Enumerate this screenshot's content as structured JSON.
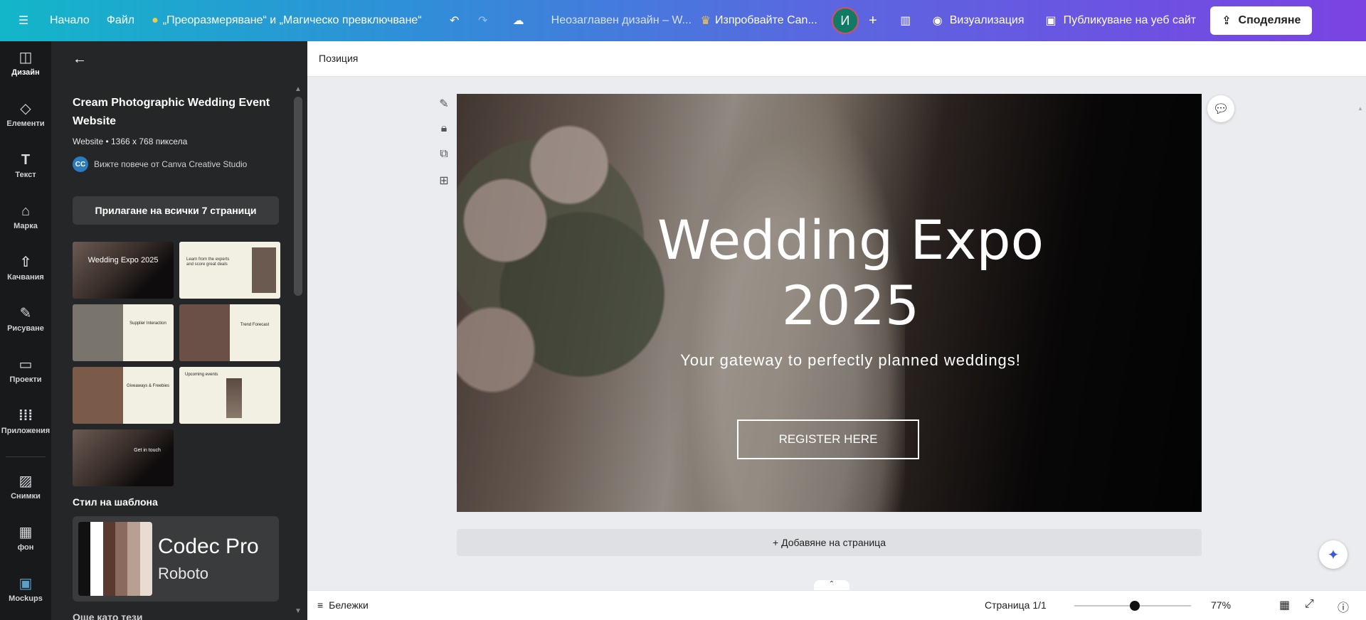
{
  "topbar": {
    "menu_icon": "hamburger-icon",
    "home": "Начало",
    "file": "Файл",
    "promo": "„Преоразмеряване“ и „Магическо превключване“",
    "design_title": "Неозаглавен дизайн – W...",
    "try_canva": "Изпробвайте Can...",
    "avatar_initial": "И",
    "visualize": "Визуализация",
    "publish": "Публикуване на уеб сайт",
    "share": "Споделяне"
  },
  "rail": {
    "items": [
      {
        "label": "Дизайн",
        "icon": "layout-icon"
      },
      {
        "label": "Елементи",
        "icon": "shapes-icon"
      },
      {
        "label": "Текст",
        "icon": "text-icon"
      },
      {
        "label": "Марка",
        "icon": "brand-icon"
      },
      {
        "label": "Качвания",
        "icon": "upload-icon"
      },
      {
        "label": "Рисуване",
        "icon": "draw-icon"
      },
      {
        "label": "Проекти",
        "icon": "folder-icon"
      },
      {
        "label": "Приложения",
        "icon": "apps-icon"
      },
      {
        "label": "Снимки",
        "icon": "photo-icon"
      },
      {
        "label": "фон",
        "icon": "background-icon"
      },
      {
        "label": "Mockups",
        "icon": "mockups-icon"
      }
    ]
  },
  "panel": {
    "template_title": "Cream Photographic Wedding Event Website",
    "template_meta": "Website • 1366 x 768 пиксела",
    "author_badge": "CC",
    "author_text": "Вижте повече от Canva Creative Studio",
    "apply_button": "Прилагане на всички 7 страници",
    "thumbs": [
      {
        "text": "Wedding Expo 2025"
      },
      {
        "text": "Learn from the experts and score great deals"
      },
      {
        "text": "Supplier Interaction"
      },
      {
        "text": "Trend Forecast"
      },
      {
        "text": "Giveaways & Freebies"
      },
      {
        "text": "Upcoming events"
      },
      {
        "text": "Get in touch"
      }
    ],
    "style_label": "Стил на шаблона",
    "palette": [
      "#111111",
      "#ffffff",
      "#5a3a30",
      "#8a6a5e",
      "#b79f92",
      "#e8dcd2"
    ],
    "font_primary": "Codec Pro",
    "font_secondary": "Roboto",
    "more_like": "Още като тези"
  },
  "editor": {
    "position_label": "Позиция",
    "hero_title_line1": "Wedding Expo",
    "hero_title_line2": "2025",
    "hero_subtitle": "Your gateway to perfectly planned weddings!",
    "hero_button": "REGISTER HERE",
    "add_page": "+ Добавяне на страница",
    "notes": "Бележки",
    "page_indicator": "Страница 1/1",
    "zoom_value": "77%",
    "zoom_fraction": 0.52
  }
}
